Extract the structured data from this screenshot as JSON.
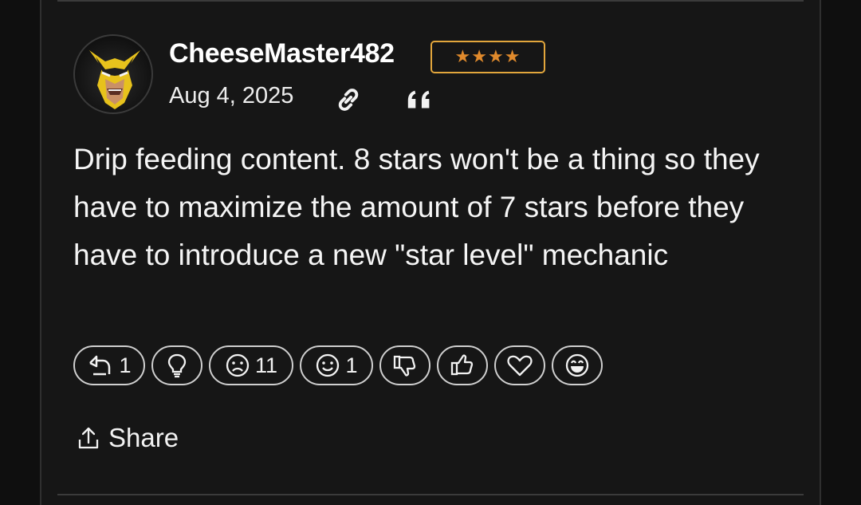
{
  "post": {
    "username": "CheeseMaster482",
    "rank_stars": "★★★★",
    "date": "Aug 4, 2025",
    "avatar": "wolverine-avatar",
    "text": "Drip feeding content. 8 stars won't be a thing so they have to maximize the amount of 7 stars before they have to introduce a new \"star level\" mechanic",
    "link_icon": "link-icon",
    "quote_icon": "quote-icon"
  },
  "reactions": [
    {
      "icon": "reply-arrow-icon",
      "count": "1"
    },
    {
      "icon": "lightbulb-icon",
      "count": ""
    },
    {
      "icon": "sad-face-icon",
      "count": "11"
    },
    {
      "icon": "smile-face-icon",
      "count": "1"
    },
    {
      "icon": "thumbs-down-icon",
      "count": ""
    },
    {
      "icon": "thumbs-up-icon",
      "count": ""
    },
    {
      "icon": "heart-icon",
      "count": ""
    },
    {
      "icon": "laugh-face-icon",
      "count": ""
    }
  ],
  "share": {
    "label": "Share",
    "icon": "share-upload-icon"
  },
  "colors": {
    "background": "#161616",
    "badge_border": "#e2a63c",
    "badge_stars": "#e08a2c",
    "text": "#f5f5f5"
  }
}
